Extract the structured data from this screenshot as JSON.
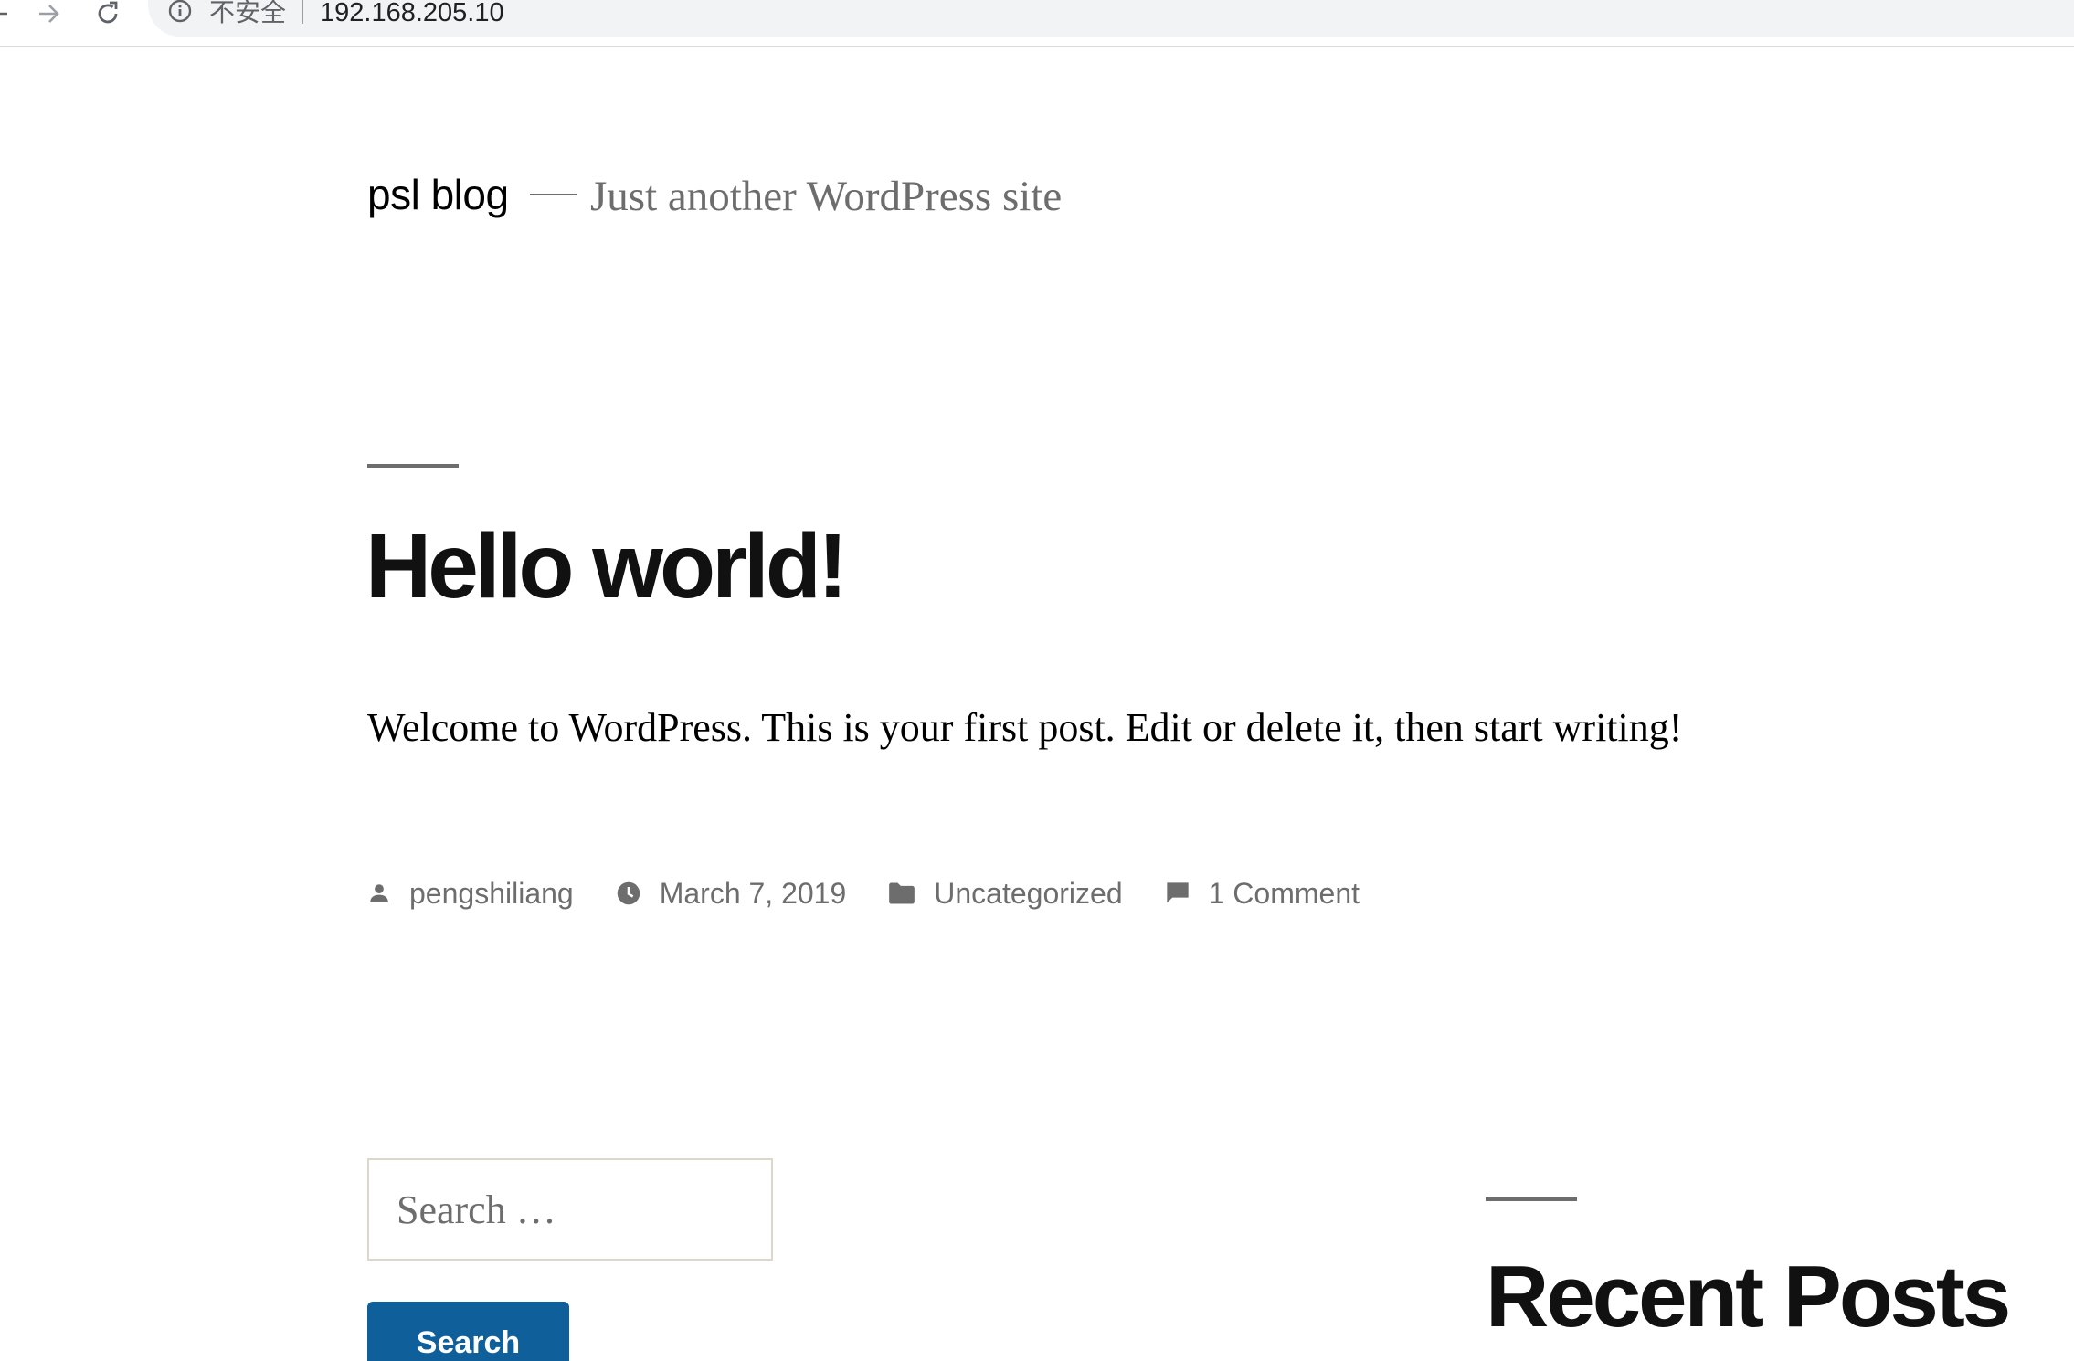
{
  "browser": {
    "security_label": "不安全",
    "url": "192.168.205.10"
  },
  "site": {
    "title": "psl blog",
    "tagline": "Just another WordPress site"
  },
  "post": {
    "title": "Hello world!",
    "content": "Welcome to WordPress. This is your first post. Edit or delete it, then start writing!",
    "meta": {
      "author": "pengshiliang",
      "date": "March 7, 2019",
      "category": "Uncategorized",
      "comments": "1 Comment"
    }
  },
  "widgets": {
    "search": {
      "placeholder": "Search …",
      "button_label": "Search"
    },
    "recent_posts_title": "Recent Posts"
  },
  "colors": {
    "accent": "#0f5f9b",
    "meta_text": "#6d6d6d",
    "omnibox_bg": "#f1f3f4"
  }
}
